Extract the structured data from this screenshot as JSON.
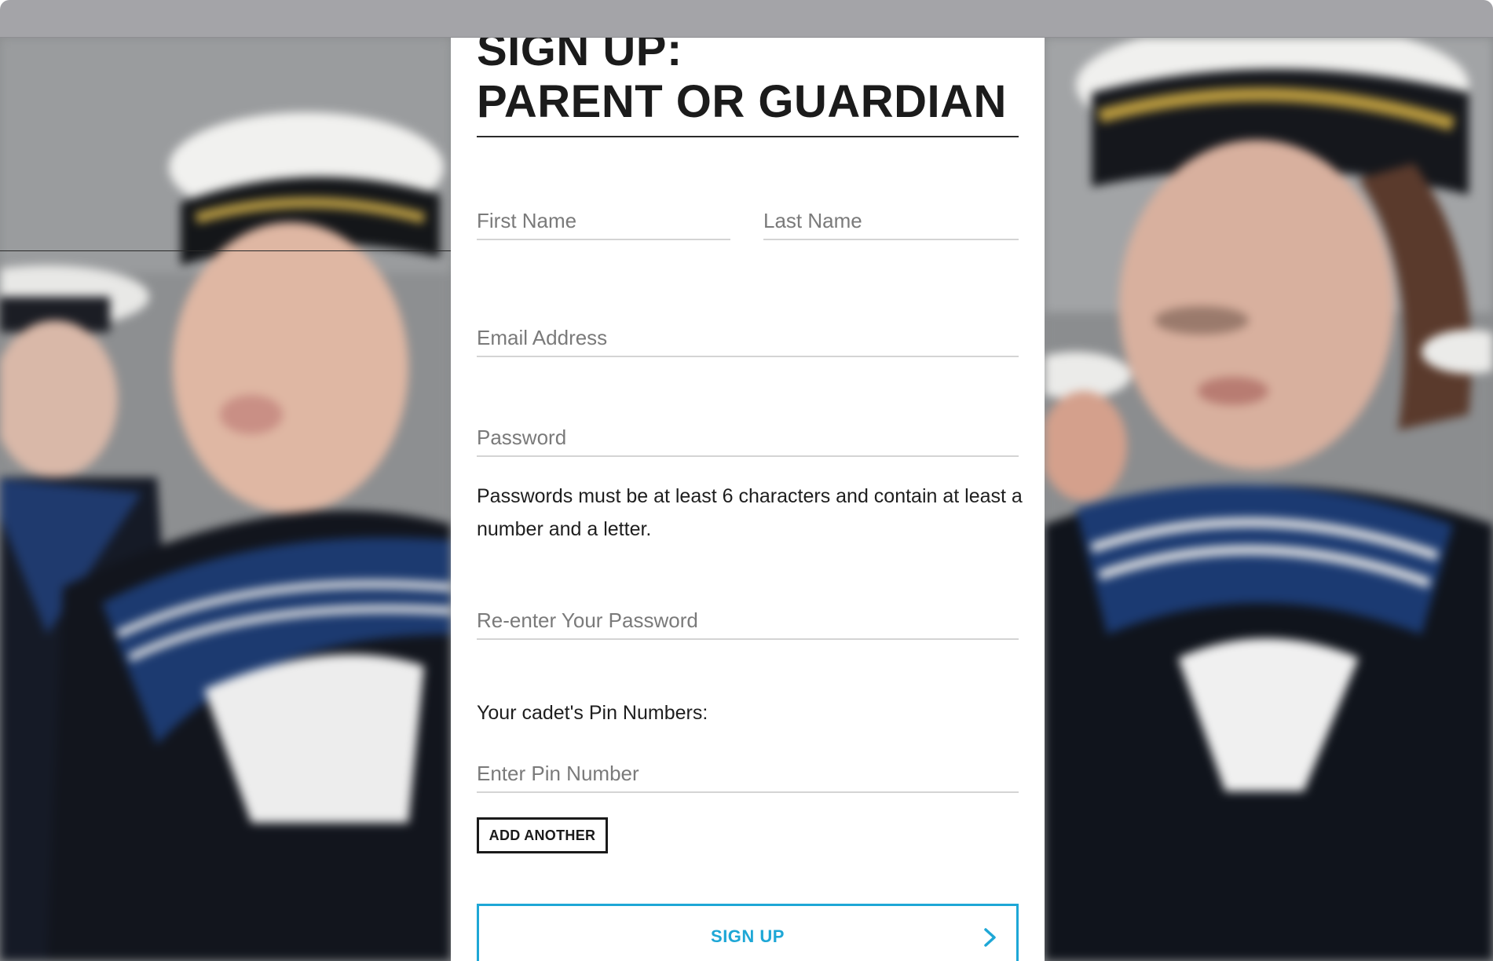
{
  "form": {
    "title_line1": "SIGN UP:",
    "title_line2": "PARENT OR GUARDIAN",
    "first_name_placeholder": "First Name",
    "last_name_placeholder": "Last Name",
    "email_placeholder": "Email Address",
    "password_placeholder": "Password",
    "password_hint": "Passwords must be at least 6 characters and contain at least a number and a letter.",
    "reenter_placeholder": "Re-enter Your Password",
    "pin_label": "Your cadet's Pin Numbers:",
    "pin_placeholder": "Enter Pin Number",
    "add_another_label": "ADD ANOTHER",
    "signup_label": "SIGN UP"
  },
  "icons": {
    "signup_arrow": "chevron-right-icon"
  },
  "colors": {
    "accent": "#1ea7d6",
    "title_text": "#1b1b1b",
    "field_underline": "#d4d4d4",
    "window_bar": "#a4a4a8"
  }
}
